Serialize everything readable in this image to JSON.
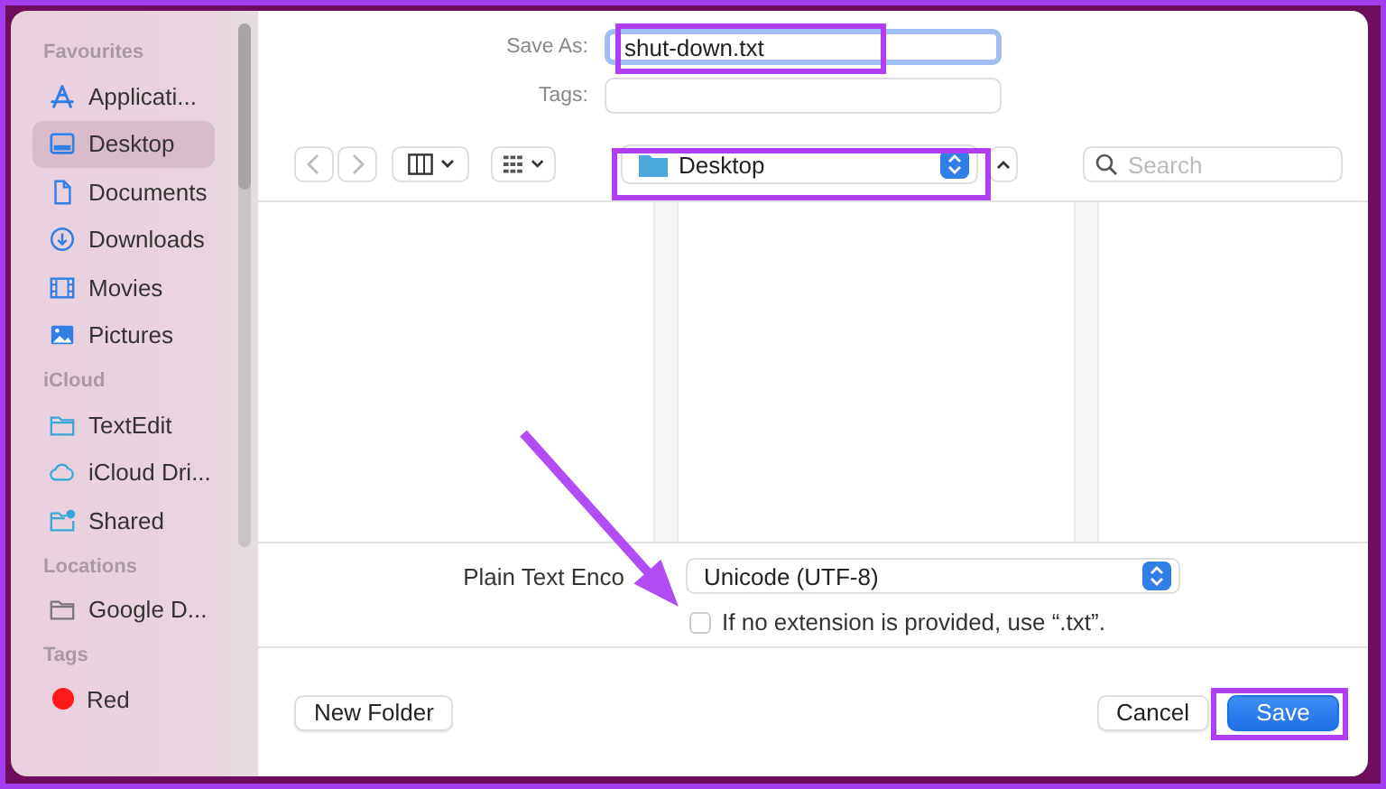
{
  "sidebar": {
    "sections": [
      {
        "title": "Favourites",
        "items": [
          {
            "label": "Applicati...",
            "selected": false
          },
          {
            "label": "Desktop",
            "selected": true
          },
          {
            "label": "Documents",
            "selected": false
          },
          {
            "label": "Downloads",
            "selected": false
          },
          {
            "label": "Movies",
            "selected": false
          },
          {
            "label": "Pictures",
            "selected": false
          }
        ]
      },
      {
        "title": "iCloud",
        "items": [
          {
            "label": "TextEdit",
            "selected": false
          },
          {
            "label": "iCloud Dri...",
            "selected": false
          },
          {
            "label": "Shared",
            "selected": false
          }
        ]
      },
      {
        "title": "Locations",
        "items": [
          {
            "label": "Google D...",
            "selected": false
          }
        ]
      },
      {
        "title": "Tags",
        "items": [
          {
            "label": "Red",
            "color": "#ff1a1a",
            "selected": false
          }
        ]
      }
    ]
  },
  "save_as": {
    "label": "Save As:",
    "value": "shut-down.txt"
  },
  "tags": {
    "label": "Tags:"
  },
  "location": {
    "value": "Desktop"
  },
  "search": {
    "placeholder": "Search"
  },
  "encoding": {
    "label": "Plain Text Enco",
    "value": "Unicode (UTF-8)"
  },
  "extension_option": {
    "label": "If no extension is provided, use “.txt”.",
    "checked": false
  },
  "buttons": {
    "new_folder": "New Folder",
    "cancel": "Cancel",
    "save": "Save"
  }
}
